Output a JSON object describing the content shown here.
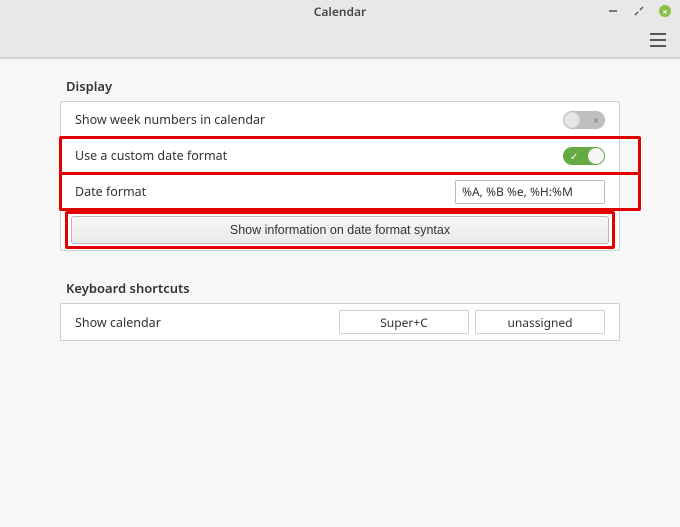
{
  "window": {
    "title": "Calendar"
  },
  "sections": {
    "display": {
      "title": "Display",
      "rows": {
        "week_numbers": {
          "label": "Show week numbers in calendar",
          "value": false
        },
        "custom_format": {
          "label": "Use a custom date format",
          "value": true
        },
        "date_format": {
          "label": "Date format",
          "value": "%A, %B %e, %H:%M"
        },
        "syntax_info": {
          "label": "Show information on date format syntax"
        }
      }
    },
    "shortcuts": {
      "title": "Keyboard shortcuts",
      "rows": {
        "show_calendar": {
          "label": "Show calendar",
          "binding1": "Super+C",
          "binding2": "unassigned"
        }
      }
    }
  }
}
